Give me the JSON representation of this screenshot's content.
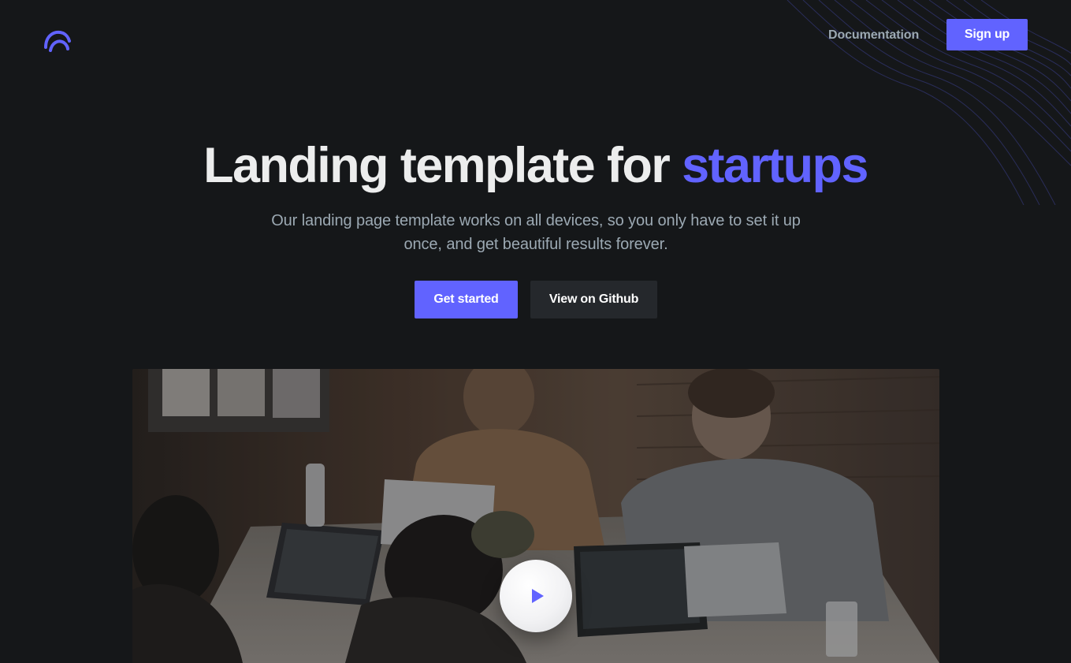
{
  "brand": {
    "logo_icon": "brand-arc-logo-icon",
    "accent_color": "#6163ff",
    "background_color": "#151719"
  },
  "nav": {
    "documentation_label": "Documentation",
    "signup_label": "Sign up"
  },
  "hero": {
    "title_main": "Landing template for ",
    "title_accent": "startups",
    "subtitle": "Our landing page template works on all devices, so you only have to set it up once, and get beautiful results forever.",
    "primary_cta": "Get started",
    "secondary_cta": "View on Github"
  },
  "video": {
    "play_icon": "play-icon"
  }
}
